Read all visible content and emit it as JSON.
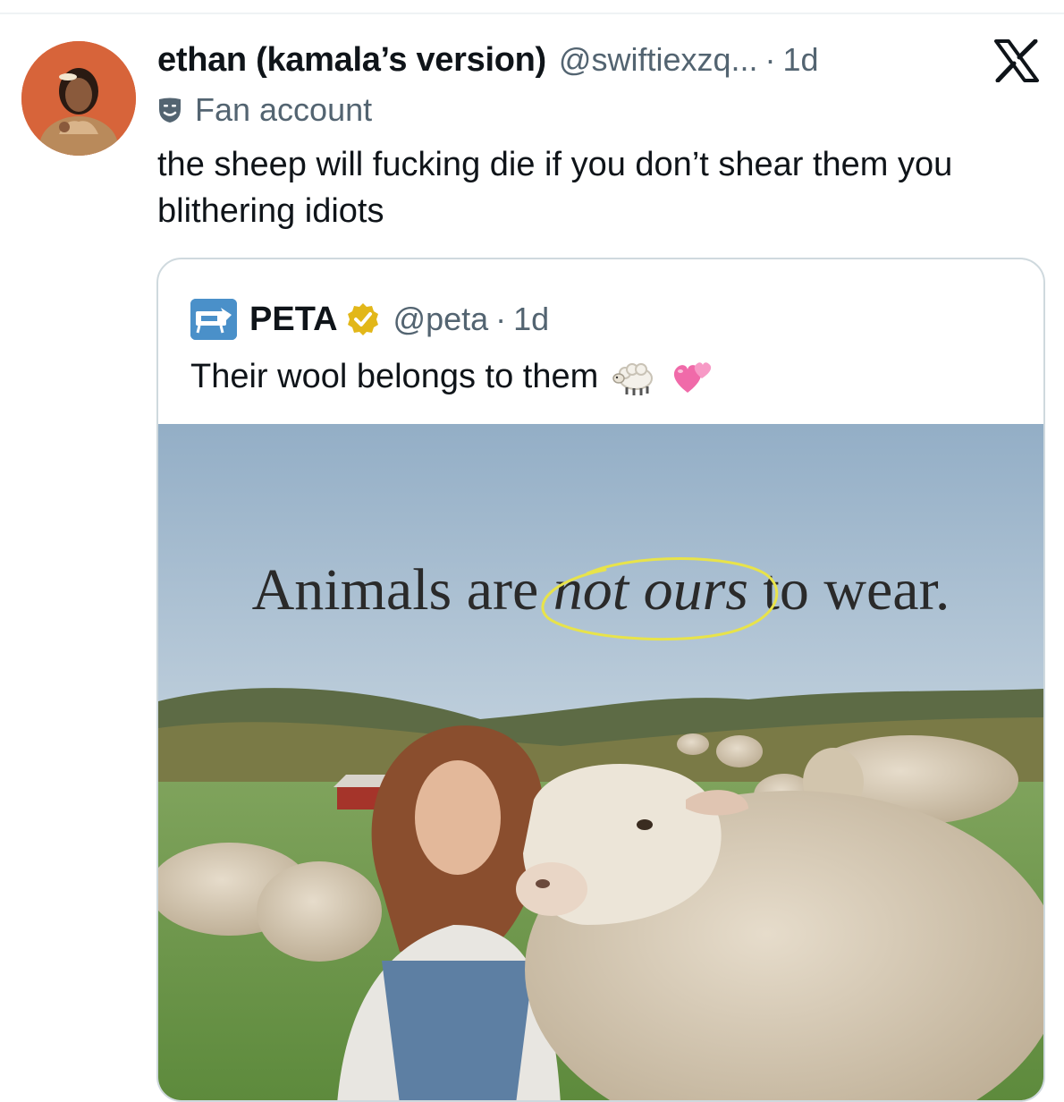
{
  "tweet": {
    "display_name": "ethan (kamala’s version)",
    "handle": "@swiftiexzq...",
    "separator": "·",
    "time": "1d",
    "label_icon": "fan-account-mask-icon",
    "label": "Fan account",
    "text": "the sheep will fucking die if you don’t shear them you blithering idiots"
  },
  "quoted": {
    "display_name": "PETA",
    "handle": "@peta",
    "separator": "·",
    "time": "1d",
    "verified": true,
    "text": "Their wool belongs to them",
    "emojis": [
      "sheep-emoji",
      "two-hearts-emoji"
    ],
    "image": {
      "headline_before": "Animals are",
      "headline_emphasis": "not ours",
      "headline_after": "to wear.",
      "highlight_color": "#e8e34a"
    }
  },
  "colors": {
    "text_primary": "#0f1419",
    "text_secondary": "#536471",
    "border": "#cfd9de",
    "verified_gold": "#e2b719",
    "peta_blue": "#4a90c9"
  }
}
